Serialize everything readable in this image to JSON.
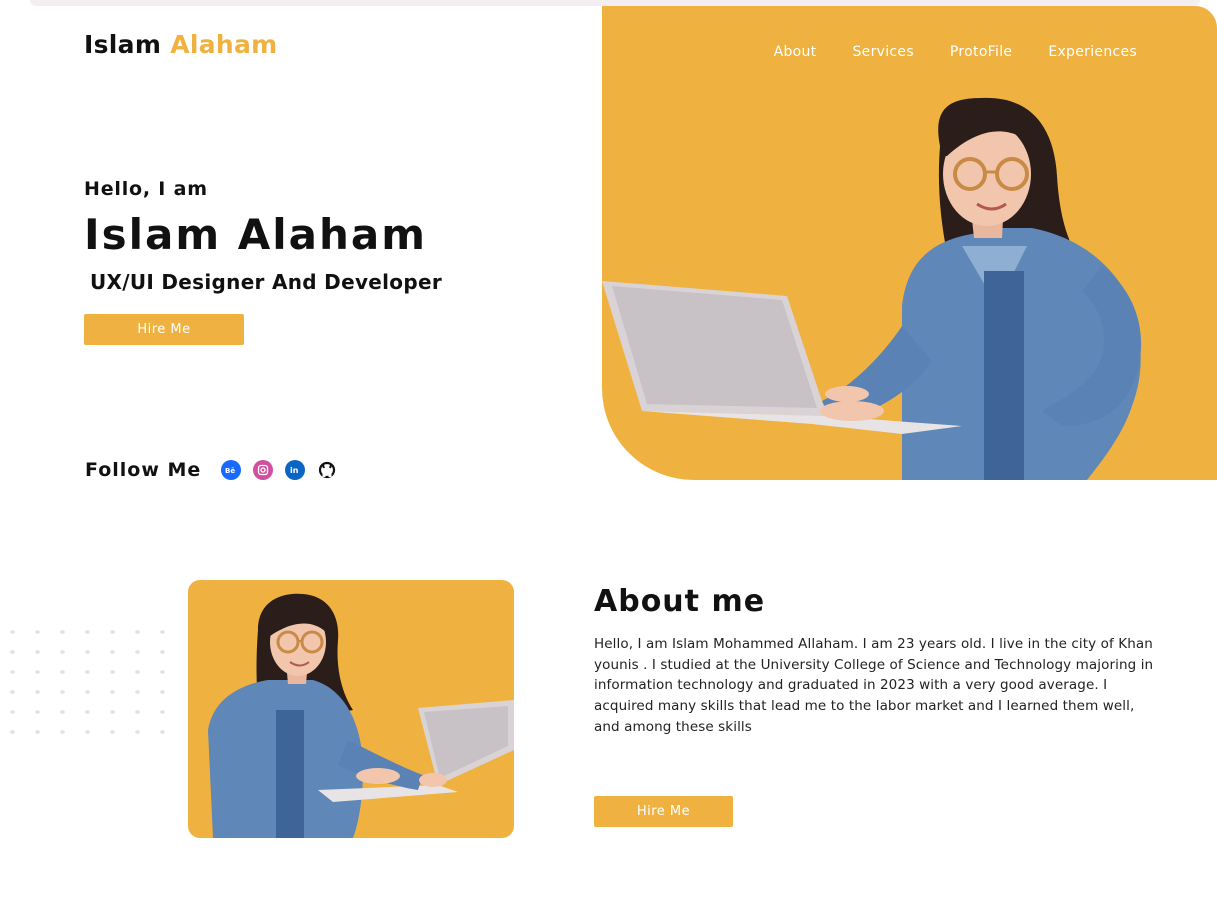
{
  "brand": {
    "first": "Islam",
    "second": "Alaham",
    "accent_color": "#EFB241"
  },
  "nav": {
    "items": [
      "About",
      "Services",
      "ProtoFile",
      "Experiences"
    ]
  },
  "hero": {
    "greeting": "Hello, I am",
    "name": "Islam Alaham",
    "role": "UX/UI Designer And Developer",
    "cta_label": "Hire Me"
  },
  "follow": {
    "label": "Follow Me",
    "icons": [
      {
        "name": "behance-icon",
        "glyph": "Bē",
        "color": "#1769ff"
      },
      {
        "name": "instagram-icon",
        "glyph": "◎",
        "color": "#d14f9e"
      },
      {
        "name": "linkedin-icon",
        "glyph": "in",
        "color": "#0a66c2"
      },
      {
        "name": "github-icon",
        "glyph": "",
        "color": "#111111"
      }
    ]
  },
  "about": {
    "title": "About me",
    "text": "Hello, I am Islam Mohammed Allaham. I am 23 years old. I live in the city of Khan younis . I studied at the University College of Science and Technology majoring in information technology and graduated in 2023 with a very good average. I acquired many skills that lead me to the labor market and I learned them well, and among these skills",
    "cta_label": "Hire Me"
  }
}
